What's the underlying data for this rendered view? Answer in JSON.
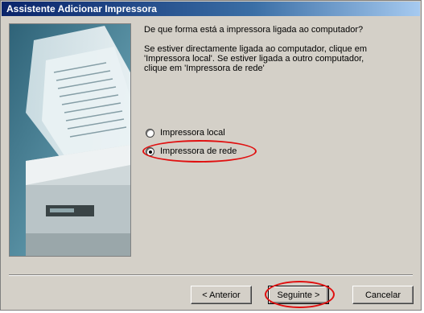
{
  "window": {
    "title": "Assistente Adicionar Impressora"
  },
  "content": {
    "question": "De que forma está a impressora ligada ao computador?",
    "description": "Se estiver directamente ligada ao computador, clique em 'Impressora local'. Se estiver ligada a outro computador, clique em 'Impressora de rede'"
  },
  "options": [
    {
      "label": "Impressora local",
      "checked": false
    },
    {
      "label": "Impressora de rede",
      "checked": true
    }
  ],
  "buttons": {
    "back": "< Anterior",
    "next": "Seguinte >",
    "cancel": "Cancelar"
  },
  "colors": {
    "titlebar": "#0a246a",
    "dialog_face": "#d4d0c8",
    "highlight": "#e01010"
  }
}
